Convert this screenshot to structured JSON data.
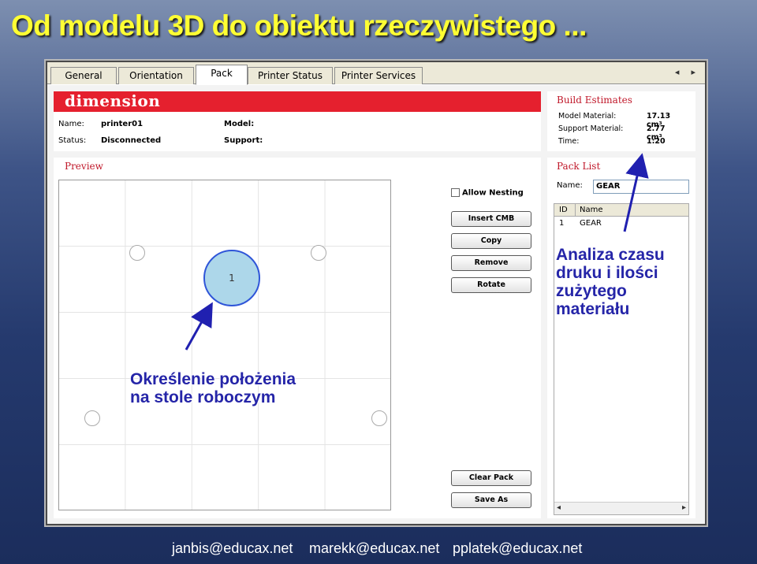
{
  "slide": {
    "title": "Od modelu 3D do obiektu rzeczywistego ..."
  },
  "tabs": [
    {
      "label": "General"
    },
    {
      "label": "Orientation"
    },
    {
      "label": "Pack"
    },
    {
      "label": "Printer Status"
    },
    {
      "label": "Printer Services"
    }
  ],
  "tab_arrows": "◂ ▸",
  "printer": {
    "logo": "dimension",
    "name_label": "Name:",
    "name_value": "printer01",
    "status_label": "Status:",
    "status_value": "Disconnected",
    "model_label": "Model:",
    "support_label": "Support:"
  },
  "estimates": {
    "title": "Build Estimates",
    "rows": [
      {
        "label": "Model Material:",
        "value": "17.13 cm³"
      },
      {
        "label": "Support Material:",
        "value": "2.77 cm³"
      },
      {
        "label": "Time:",
        "value": "1:20"
      }
    ]
  },
  "preview": {
    "title": "Preview",
    "part_label": "1"
  },
  "controls": {
    "allow_nesting": "Allow Nesting",
    "insert_cmb": "Insert CMB",
    "copy": "Copy",
    "remove": "Remove",
    "rotate": "Rotate",
    "clear_pack": "Clear Pack",
    "save_as": "Save As"
  },
  "packlist": {
    "title": "Pack List",
    "name_label": "Name:",
    "name_value": "GEAR",
    "columns": [
      "ID",
      "Name"
    ],
    "rows": [
      {
        "id": "1",
        "name": "GEAR"
      }
    ]
  },
  "annotations": {
    "analysis": [
      "Analiza czasu",
      "druku i ilości",
      "zużytego",
      "materiału"
    ],
    "position": [
      "Określenie położenia",
      "na stole roboczym"
    ]
  },
  "footer": {
    "emails": [
      "janbis@educax.net",
      "marekk@educax.net",
      "pplatek@educax.net"
    ]
  },
  "colors": {
    "title": "#ffff33",
    "logo_bar": "#e5202e",
    "annotation": "#2525a8",
    "part_fill": "#add7ea"
  }
}
